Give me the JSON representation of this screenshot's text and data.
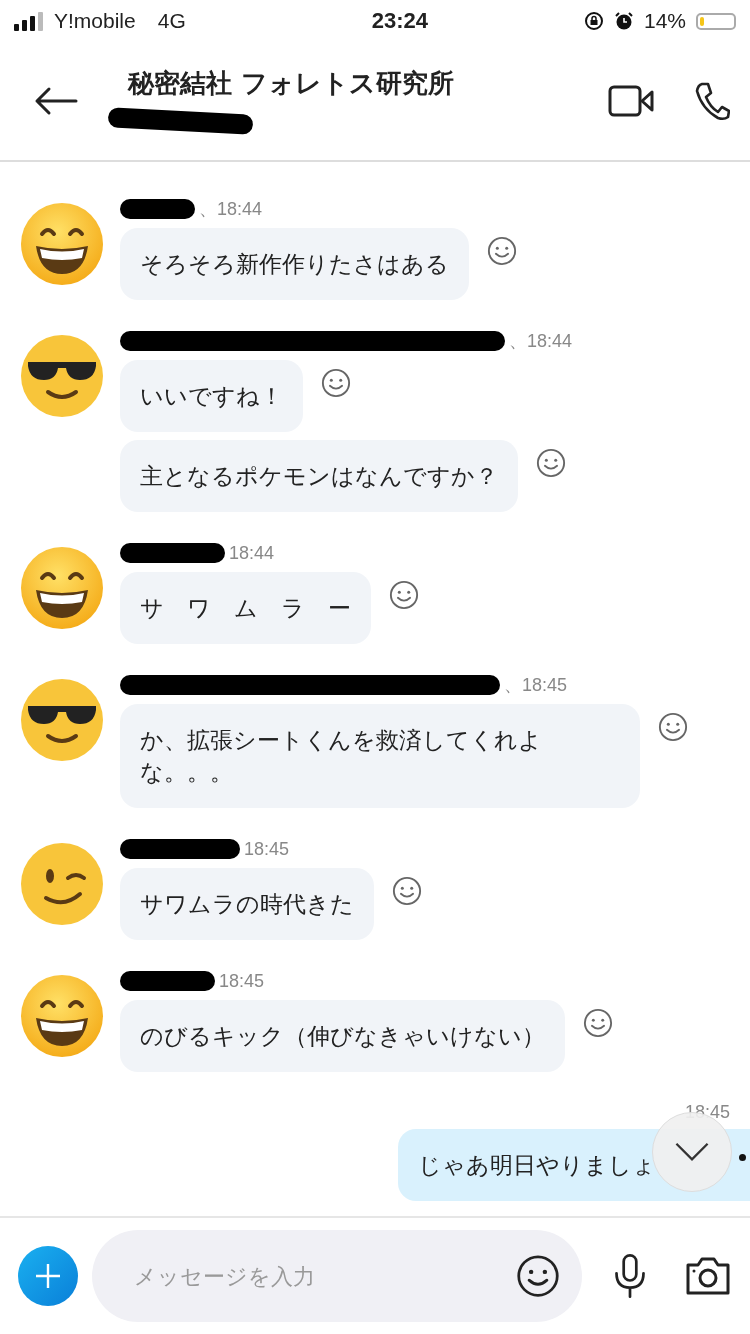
{
  "status_bar": {
    "carrier": "Y!mobile",
    "network": "4G",
    "time": "23:24",
    "battery_percent": "14%",
    "battery": {
      "level": 0.14
    }
  },
  "header": {
    "title": "秘密結社 フォレトス研究所"
  },
  "messages": [
    {
      "kind": "incoming",
      "avatar": {
        "kind": "grin"
      },
      "time": "、18:44",
      "bubbles": [
        "そろそろ新作作りたさはある"
      ]
    },
    {
      "kind": "incoming",
      "avatar": {
        "kind": "sunglasses"
      },
      "time": "、18:44",
      "bubbles": [
        "いいですね！",
        "主となるポケモンはなんですか？"
      ]
    },
    {
      "kind": "incoming",
      "avatar": {
        "kind": "grin"
      },
      "time": "18:44",
      "bubbles": [
        "サ　ワ　ム　ラ　ー"
      ]
    },
    {
      "kind": "incoming",
      "avatar": {
        "kind": "sunglasses"
      },
      "time": "、18:45",
      "bubbles": [
        "か、拡張シートくんを救済してくれよな。。。"
      ]
    },
    {
      "kind": "incoming",
      "avatar": {
        "kind": "wink"
      },
      "time": "18:45",
      "bubbles": [
        "サワムラの時代きた"
      ]
    },
    {
      "kind": "incoming",
      "avatar": {
        "kind": "grin"
      },
      "time": "18:45",
      "bubbles": [
        "のびるキック（伸びなきゃいけない）"
      ]
    },
    {
      "kind": "outgoing",
      "time": "18:45",
      "bubbles": [
        "じゃあ明日やりましょ"
      ]
    }
  ],
  "composer": {
    "placeholder": "メッセージを入力"
  }
}
